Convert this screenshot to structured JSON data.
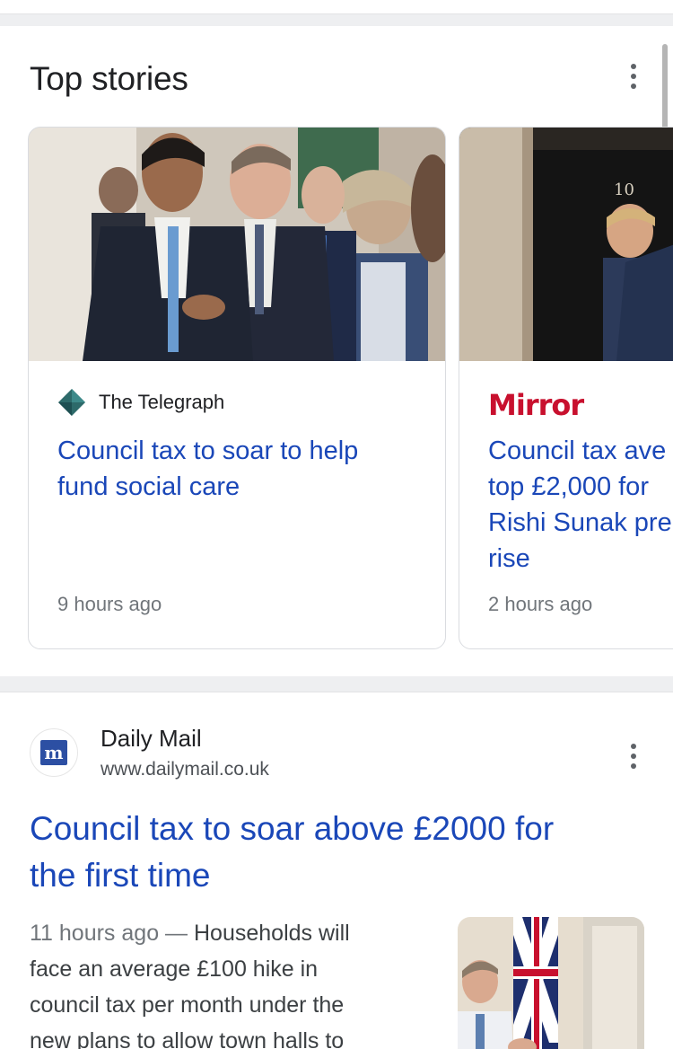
{
  "section": {
    "title": "Top stories"
  },
  "stories": [
    {
      "source": "The Telegraph",
      "headline_lines": [
        "Council tax to soar to help",
        "fund social care"
      ],
      "time": "9 hours ago"
    },
    {
      "source": "Mirror",
      "headline_lines": [
        "Council tax ave",
        "top £2,000 for",
        "Rishi Sunak pre",
        "rise"
      ],
      "time": "2 hours ago"
    }
  ],
  "result": {
    "site_name": "Daily Mail",
    "url": "www.dailymail.co.uk",
    "favicon_letter": "m",
    "title_lines": [
      "Council tax to soar above £2000 for",
      "the first time"
    ],
    "time": "11 hours ago",
    "separator": " — ",
    "snippet_lines": [
      "Households will",
      "face an average £100 hike in",
      "council tax per month under the",
      "new plans to allow town halls to"
    ]
  },
  "colors": {
    "link": "#1a47b8",
    "mirror_red": "#c8102e",
    "telegraph_diamond": "#2d6a6a",
    "dailymail_blue": "#2c4fa3"
  }
}
